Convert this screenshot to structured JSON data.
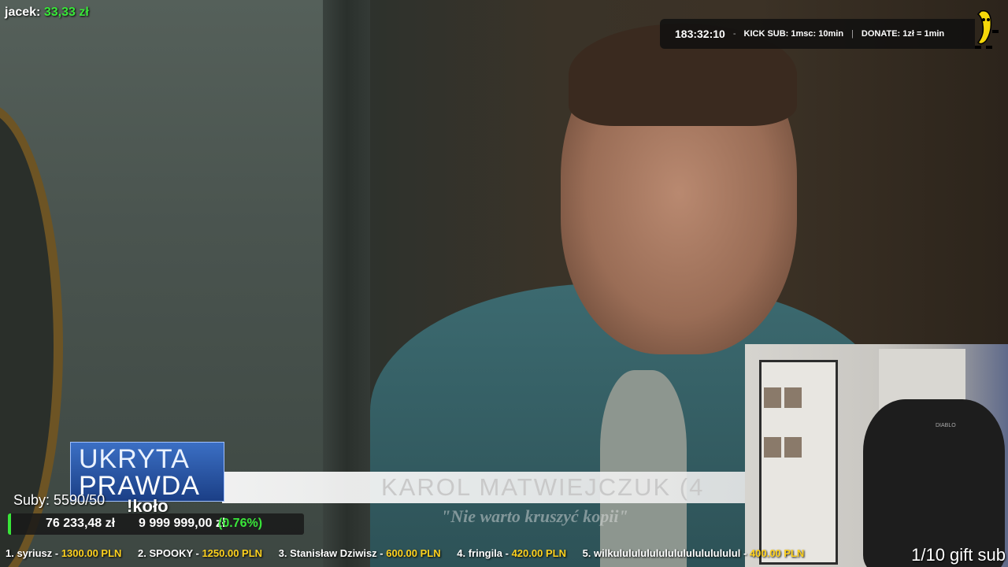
{
  "donor": {
    "name": "jacek:",
    "amount": "33,33 zł"
  },
  "topbar": {
    "timer": "183:32:10",
    "sep1": "-",
    "kick_sub": "KICK SUB: 1msc: 10min",
    "sep2": "|",
    "donate": "DONATE: 1zł = 1min"
  },
  "lower_third": {
    "logo_line1": "UKRYTA",
    "logo_line2": "PRAWDA",
    "name": "KAROL MATWIEJCZUK (4",
    "quote": "\"Nie warto kruszyć kopii\""
  },
  "goal": {
    "subs": "Suby: 5590/50",
    "command": "!koło",
    "raised": "76 233,48 zł",
    "target": "9 999 999,00 zł",
    "percent": "(0.76%)",
    "progress": 0.0076
  },
  "webcam": {
    "gift_text": "1/10 gift sub",
    "chair_brand": "DIABLO"
  },
  "ticker": [
    {
      "name": "1. syriusz - ",
      "value": "1300.00 PLN"
    },
    {
      "name": "2. SPOOKY - ",
      "value": "1250.00 PLN"
    },
    {
      "name": "3. Stanisław Dziwisz - ",
      "value": "600.00 PLN"
    },
    {
      "name": "4. fringila - ",
      "value": "420.00 PLN"
    },
    {
      "name": "5. wilkulululululululululululululul - ",
      "value": "400.00 PLN"
    }
  ],
  "colors": {
    "green": "#39e639",
    "yellow": "#ffd21e",
    "logo_blue": "#2a56a8"
  }
}
